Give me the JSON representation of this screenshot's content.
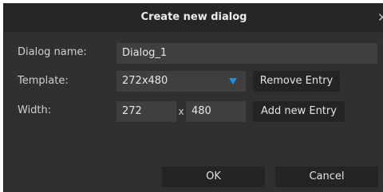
{
  "window": {
    "title": "Create new dialog"
  },
  "labels": {
    "dialog_name": "Dialog name:",
    "template": "Template:",
    "width": "Width:"
  },
  "fields": {
    "dialog_name_value": "Dialog_1",
    "template_value": "272x480",
    "width_value": "272",
    "height_value": "480",
    "separator": "x"
  },
  "buttons": {
    "remove_entry": "Remove Entry",
    "add_new_entry": "Add new Entry",
    "ok": "OK",
    "cancel": "Cancel"
  },
  "colors": {
    "dropdown_arrow": "#1e8fe0"
  }
}
